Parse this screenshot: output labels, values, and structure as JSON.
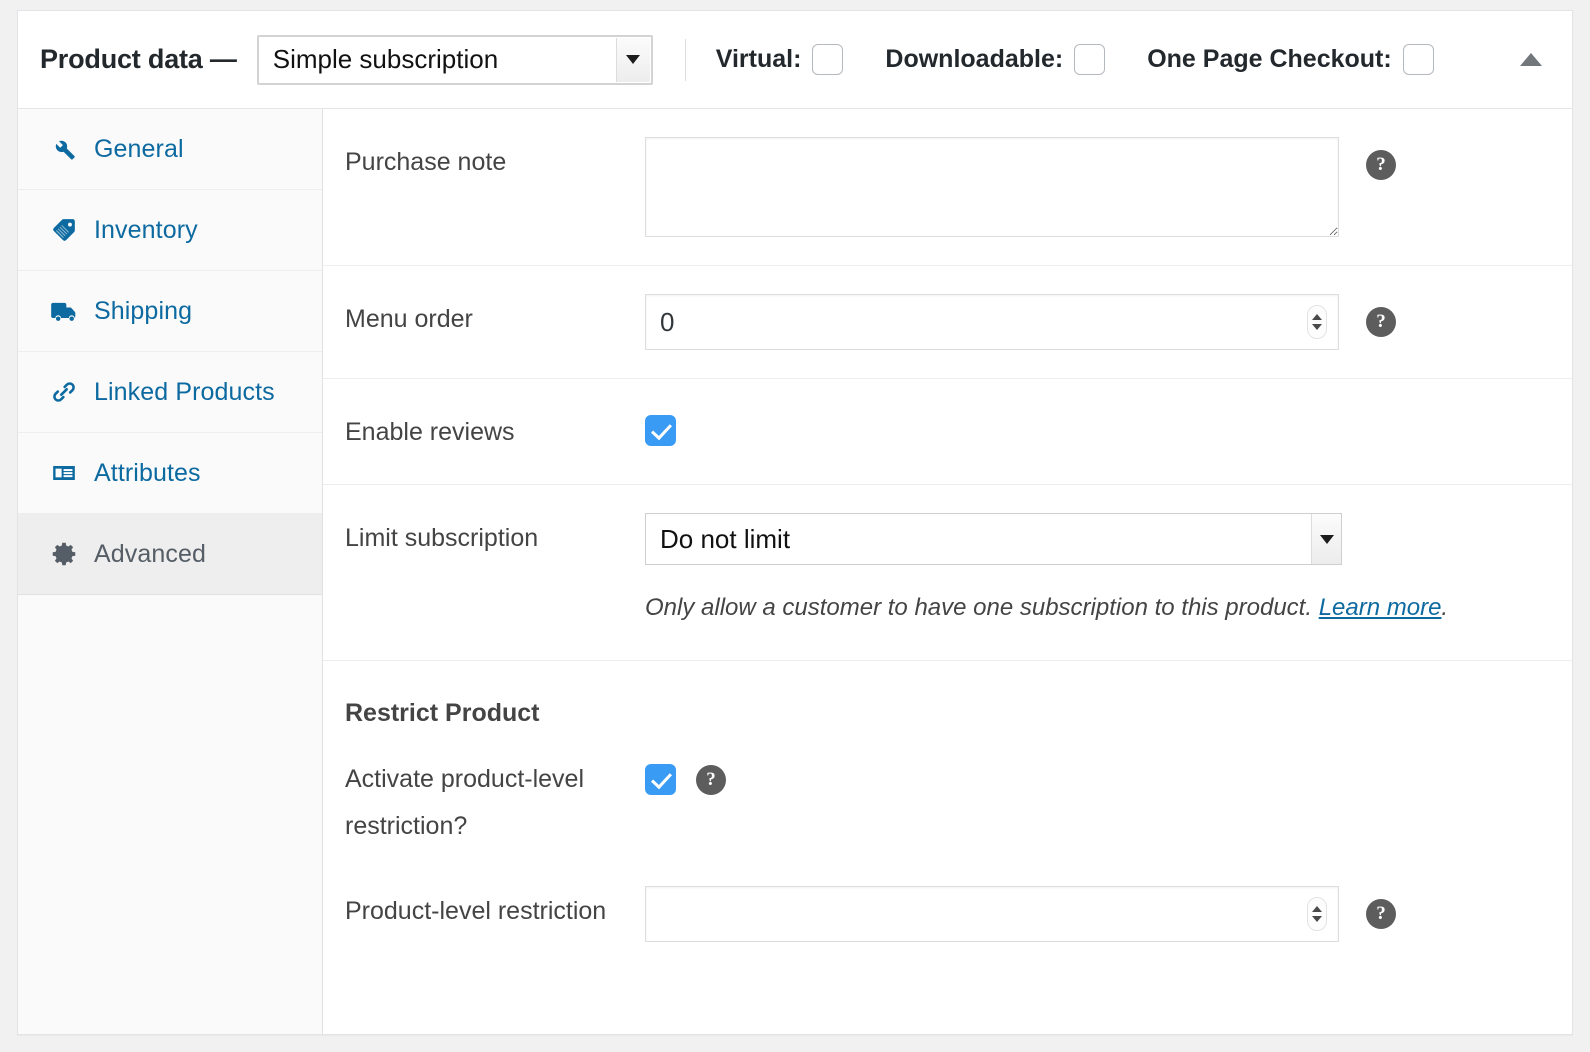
{
  "header": {
    "title": "Product data —",
    "product_type": "Simple subscription",
    "checks": [
      {
        "label": "Virtual:",
        "checked": false
      },
      {
        "label": "Downloadable:",
        "checked": false
      },
      {
        "label": "One Page Checkout:",
        "checked": false
      }
    ],
    "collapse_icon": "triangle-up-icon"
  },
  "tabs": [
    {
      "label": "General",
      "icon": "wrench-icon",
      "active": false
    },
    {
      "label": "Inventory",
      "icon": "tag-icon",
      "active": false
    },
    {
      "label": "Shipping",
      "icon": "truck-icon",
      "active": false
    },
    {
      "label": "Linked Products",
      "icon": "link-icon",
      "active": false
    },
    {
      "label": "Attributes",
      "icon": "list-icon",
      "active": false
    },
    {
      "label": "Advanced",
      "icon": "gear-icon",
      "active": true
    }
  ],
  "fields": {
    "purchase_note": {
      "label": "Purchase note",
      "value": "",
      "placeholder": "",
      "help": "?"
    },
    "menu_order": {
      "label": "Menu order",
      "value": "0",
      "help": "?"
    },
    "enable_reviews": {
      "label": "Enable reviews",
      "checked": true
    },
    "limit_subscription": {
      "label": "Limit subscription",
      "value": "Do not limit",
      "description_before": "Only allow a customer to have one subscription to this product. ",
      "description_link": "Learn more",
      "description_after": "."
    }
  },
  "restrict_product": {
    "section_title": "Restrict Product",
    "activate": {
      "label_line1": "Activate product-level",
      "label_line2": "restriction?",
      "checked": true,
      "help": "?"
    },
    "product_level_restriction": {
      "label": "Product-level restriction",
      "value": "",
      "help": "?"
    }
  },
  "colors": {
    "link": "#0d6aa1",
    "checkbox_on": "#3a9bf4",
    "active_tab_bg": "#eeeeee",
    "help_bg": "#5d5d5d"
  }
}
